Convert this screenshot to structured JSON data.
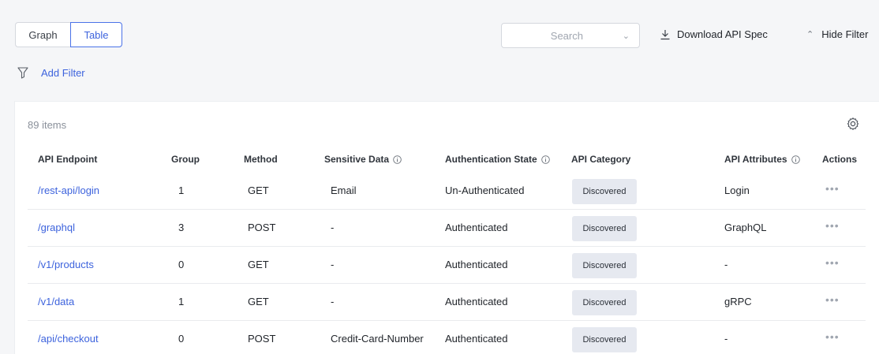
{
  "view_toggle": {
    "graph": "Graph",
    "table": "Table"
  },
  "search": {
    "placeholder": "Search"
  },
  "download_label": "Download API Spec",
  "hide_filter_label": "Hide Filter",
  "add_filter_label": "Add Filter",
  "items_count": "89 items",
  "columns": {
    "endpoint": "API Endpoint",
    "group": "Group",
    "method": "Method",
    "sensitive": "Sensitive Data",
    "auth": "Authentication State",
    "category": "API Category",
    "attributes": "API Attributes",
    "actions": "Actions"
  },
  "rows": [
    {
      "endpoint": "/rest-api/login",
      "group": "1",
      "method": "GET",
      "sensitive": "Email",
      "auth": "Un-Authenticated",
      "category": "Discovered",
      "attributes": "Login",
      "actions": "•••"
    },
    {
      "endpoint": "/graphql",
      "group": "3",
      "method": "POST",
      "sensitive": "-",
      "auth": "Authenticated",
      "category": "Discovered",
      "attributes": "GraphQL",
      "actions": "•••"
    },
    {
      "endpoint": "/v1/products",
      "group": "0",
      "method": "GET",
      "sensitive": "-",
      "auth": "Authenticated",
      "category": "Discovered",
      "attributes": "-",
      "actions": "•••"
    },
    {
      "endpoint": "/v1/data",
      "group": "1",
      "method": "GET",
      "sensitive": "-",
      "auth": "Authenticated",
      "category": "Discovered",
      "attributes": "gRPC",
      "actions": "•••"
    },
    {
      "endpoint": "/api/checkout",
      "group": "0",
      "method": "POST",
      "sensitive": "Credit-Card-Number",
      "auth": "Authenticated",
      "category": "Discovered",
      "attributes": "-",
      "actions": "•••"
    }
  ],
  "colors": {
    "accent": "#3d63dd",
    "badge_bg": "#e6e9f0"
  },
  "icons": {
    "filter": "filter-icon",
    "download": "download-icon",
    "gear": "gear-icon",
    "info": "info-icon"
  }
}
